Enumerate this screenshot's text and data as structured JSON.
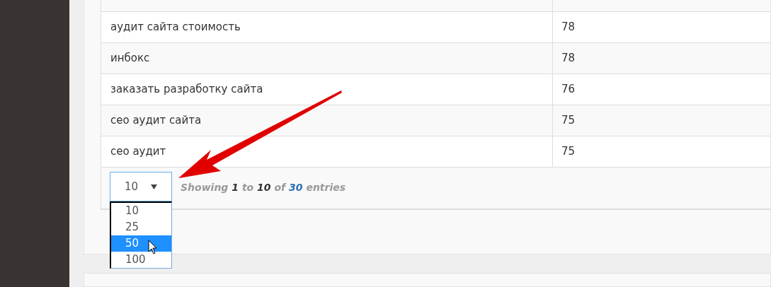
{
  "table": {
    "rows": [
      {
        "keyword": "аудит сайта стоимость",
        "count": "78"
      },
      {
        "keyword": "инбокс",
        "count": "78"
      },
      {
        "keyword": "заказать разработку сайта",
        "count": "76"
      },
      {
        "keyword": "сео аудит сайта",
        "count": "75"
      },
      {
        "keyword": "сео аудит",
        "count": "75"
      }
    ]
  },
  "length_select": {
    "value": "10",
    "options": [
      {
        "label": "10",
        "highlighted": false
      },
      {
        "label": "25",
        "highlighted": false
      },
      {
        "label": "50",
        "highlighted": true
      },
      {
        "label": "100",
        "highlighted": false
      }
    ]
  },
  "info": [
    {
      "text": "Showing",
      "kind": "plain"
    },
    {
      "text": "1",
      "kind": "strong"
    },
    {
      "text": "to",
      "kind": "plain"
    },
    {
      "text": "10",
      "kind": "strong"
    },
    {
      "text": "of",
      "kind": "plain"
    },
    {
      "text": "30",
      "kind": "total"
    },
    {
      "text": "entries",
      "kind": "plain"
    }
  ]
}
